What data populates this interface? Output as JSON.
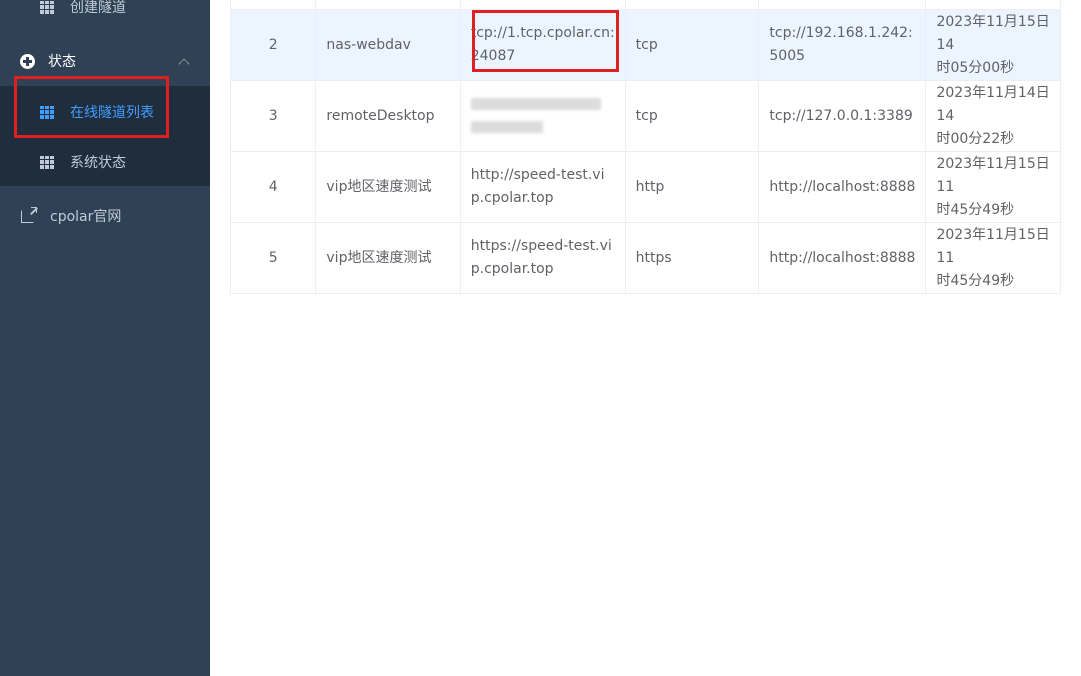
{
  "sidebar": {
    "create_tunnel": "创建隧道",
    "status_group": "状态",
    "online_tunnels": "在线隧道列表",
    "system_status": "系统状态",
    "cpolar_site": "cpolar官网"
  },
  "colors": {
    "sidebar_bg": "#304156",
    "submenu_bg": "#1f2d3d",
    "active": "#409eff",
    "highlight_row": "#ecf5ff",
    "annotation_red": "#e02020"
  },
  "tunnels": {
    "rows": [
      {
        "index": "2",
        "name": "nas-webdav",
        "public_url_1": "tcp://1.tcp.cpolar.cn:",
        "public_url_2": "24087",
        "protocol": "tcp",
        "local_1": "tcp://192.168.1.242:",
        "local_2": "5005",
        "time_1": "2023年11月15日 14",
        "time_2": "时05分00秒"
      },
      {
        "index": "3",
        "name": "remoteDesktop",
        "public_url_1": "",
        "public_url_2": "",
        "protocol": "tcp",
        "local_1": "tcp://127.0.0.1:3389",
        "local_2": "",
        "time_1": "2023年11月14日 14",
        "time_2": "时00分22秒"
      },
      {
        "index": "4",
        "name": "vip地区速度测试",
        "public_url_1": "http://speed-test.vi",
        "public_url_2": "p.cpolar.top",
        "protocol": "http",
        "local_1": "http://localhost:8888",
        "local_2": "",
        "time_1": "2023年11月15日 11",
        "time_2": "时45分49秒"
      },
      {
        "index": "5",
        "name": "vip地区速度测试",
        "public_url_1": "https://speed-test.vi",
        "public_url_2": "p.cpolar.top",
        "protocol": "https",
        "local_1": "http://localhost:8888",
        "local_2": "",
        "time_1": "2023年11月15日 11",
        "time_2": "时45分49秒"
      }
    ]
  }
}
